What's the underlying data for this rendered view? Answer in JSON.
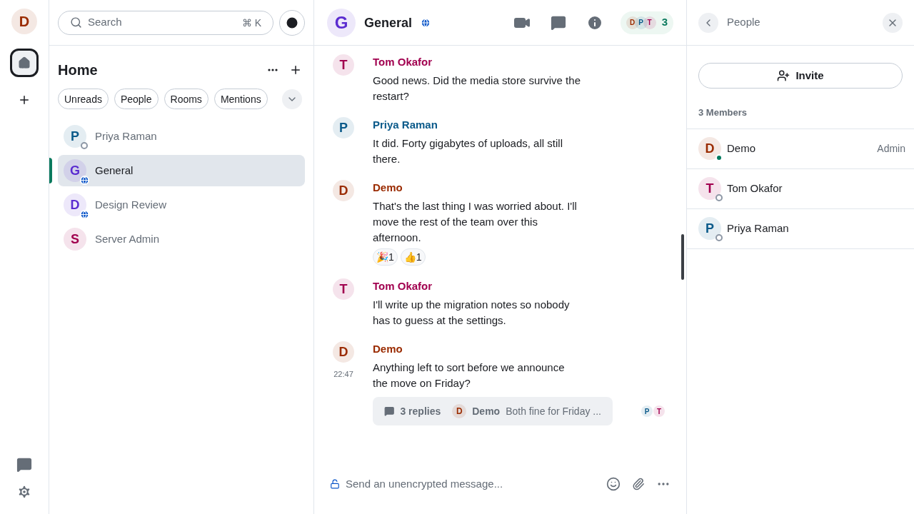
{
  "rail": {
    "user": {
      "initial": "D",
      "color": "#9a2b00"
    },
    "home_selected": true
  },
  "search": {
    "placeholder": "Search",
    "shortcut": "⌘ K"
  },
  "home": {
    "title": "Home",
    "filters": [
      {
        "label": "Unreads",
        "selected": false
      },
      {
        "label": "People",
        "selected": false
      },
      {
        "label": "Rooms",
        "selected": false
      },
      {
        "label": "Mentions",
        "selected": false
      }
    ],
    "rooms": [
      {
        "initial": "P",
        "name": "Priya Raman",
        "color": "#0b5a8a",
        "kind": "dm",
        "online": false,
        "selected": false
      },
      {
        "initial": "G",
        "name": "General",
        "color": "#5b2cd0",
        "kind": "room",
        "selected": true
      },
      {
        "initial": "D",
        "name": "Design Review",
        "color": "#5b2cd0",
        "kind": "room",
        "selected": false
      },
      {
        "initial": "S",
        "name": "Server Admin",
        "color": "#a1004f",
        "kind": "plain",
        "selected": false
      }
    ]
  },
  "room": {
    "initial": "G",
    "name": "General",
    "color": "#5b2cd0",
    "members": [
      {
        "initial": "D",
        "color": "#9a2b00"
      },
      {
        "initial": "P",
        "color": "#0b5a8a"
      },
      {
        "initial": "T",
        "color": "#a1004f"
      }
    ],
    "member_count": "3"
  },
  "messages": [
    {
      "initial": "T",
      "sender": "Tom Okafor",
      "color": "#a1004f",
      "text": "Good news. Did the media store survive the restart?"
    },
    {
      "initial": "P",
      "sender": "Priya Raman",
      "color": "#0b5a8a",
      "text": "It did. Forty gigabytes of uploads, all still there."
    },
    {
      "initial": "D",
      "sender": "Demo",
      "color": "#9a2b00",
      "text": "That's the last thing I was worried about. I'll move the rest of the team over this afternoon.",
      "reactions": [
        {
          "emoji": "🎉",
          "count": "1"
        },
        {
          "emoji": "👍",
          "count": "1"
        }
      ]
    },
    {
      "initial": "T",
      "sender": "Tom Okafor",
      "color": "#a1004f",
      "text": "I'll write up the migration notes so nobody has to guess at the settings."
    },
    {
      "initial": "D",
      "sender": "Demo",
      "color": "#9a2b00",
      "time": "22:47",
      "text": "Anything left to sort before we announce the move on Friday?",
      "thread": {
        "count": "3 replies",
        "initial": "D",
        "color": "#9a2b00",
        "author": "Demo",
        "preview": "Both fine for Friday ..."
      },
      "receipts": [
        {
          "initial": "P",
          "color": "#0b5a8a"
        },
        {
          "initial": "T",
          "color": "#a1004f"
        }
      ]
    }
  ],
  "composer": {
    "placeholder": "Send an unencrypted message..."
  },
  "people": {
    "title": "People",
    "invite": "Invite",
    "count": "3 Members",
    "members": [
      {
        "initial": "D",
        "name": "Demo",
        "color": "#9a2b00",
        "online": true,
        "role": "Admin"
      },
      {
        "initial": "T",
        "name": "Tom Okafor",
        "color": "#a1004f",
        "online": false
      },
      {
        "initial": "P",
        "name": "Priya Raman",
        "color": "#0b5a8a",
        "online": false
      }
    ]
  }
}
